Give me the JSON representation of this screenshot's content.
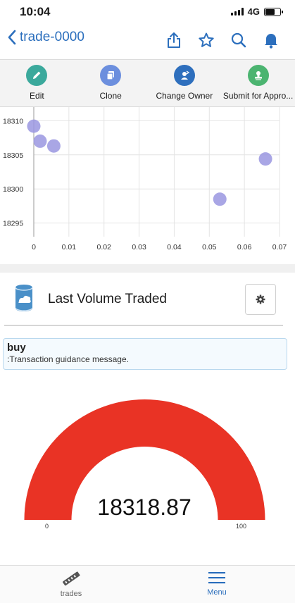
{
  "status_bar": {
    "time": "10:04",
    "network": "4G"
  },
  "header": {
    "title": "trade-0000"
  },
  "actions": [
    {
      "label": "Edit",
      "icon": "edit-icon",
      "color": "#3ba99c"
    },
    {
      "label": "Clone",
      "icon": "clone-icon",
      "color": "#6c8fde"
    },
    {
      "label": "Change Owner",
      "icon": "change-owner-icon",
      "color": "#2e6fbd"
    },
    {
      "label": "Submit for Appro...",
      "icon": "submit-approval-icon",
      "color": "#4bb470"
    }
  ],
  "chart_data": {
    "type": "scatter",
    "xlim": [
      0,
      0.07
    ],
    "ylim": [
      18293,
      18312
    ],
    "x_ticks": [
      "0",
      "0.01",
      "0.02",
      "0.03",
      "0.04",
      "0.05",
      "0.06",
      "0.07"
    ],
    "y_ticks": [
      "18295",
      "18300",
      "18305",
      "18310"
    ],
    "points": [
      {
        "x": 0.0,
        "y": 18309.2
      },
      {
        "x": 0.0018,
        "y": 18307.0
      },
      {
        "x": 0.0057,
        "y": 18306.3
      },
      {
        "x": 0.053,
        "y": 18298.5
      },
      {
        "x": 0.066,
        "y": 18304.4
      }
    ],
    "point_color": "#9a97e0",
    "grid": true
  },
  "card": {
    "title": "Last Volume Traded",
    "icon": "database-cloud-icon"
  },
  "message": {
    "title": "buy",
    "text": ":Transaction guidance message."
  },
  "gauge": {
    "value": "18318.87",
    "min": "0",
    "max": "100",
    "fill_fraction": 1.0,
    "color": "#e93325"
  },
  "tabs": [
    {
      "label": "trades",
      "icon": "trades-icon"
    },
    {
      "label": "Menu",
      "icon": "menu-icon"
    }
  ],
  "colors": {
    "accent": "#2c6fbd"
  }
}
